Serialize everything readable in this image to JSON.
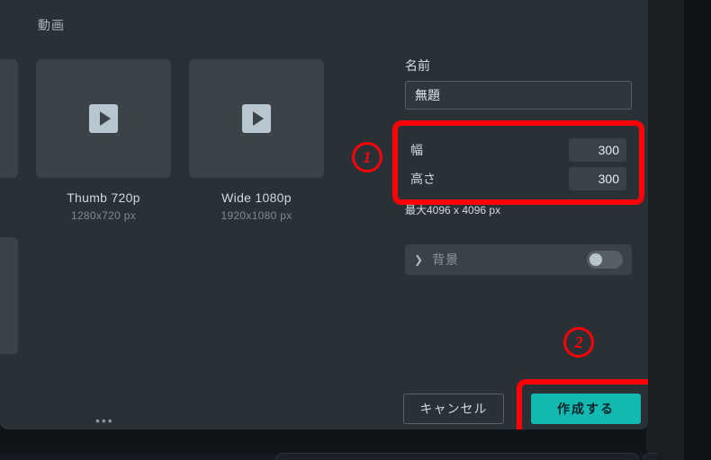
{
  "section_label": "動画",
  "templates": [
    {
      "title": "Thumb 720p",
      "dim": "1280x720 px"
    },
    {
      "title": "Wide 1080p",
      "dim": "1920x1080 px"
    }
  ],
  "dots": "•••",
  "form": {
    "name_label": "名前",
    "name_value": "無題",
    "width_label": "幅",
    "width_value": "300",
    "height_label": "高さ",
    "height_value": "300",
    "max_note": "最大4096 x 4096 px",
    "background_label": "背景"
  },
  "buttons": {
    "cancel": "キャンセル",
    "create": "作成する"
  },
  "annotations": {
    "step1": "1",
    "step2": "2"
  }
}
